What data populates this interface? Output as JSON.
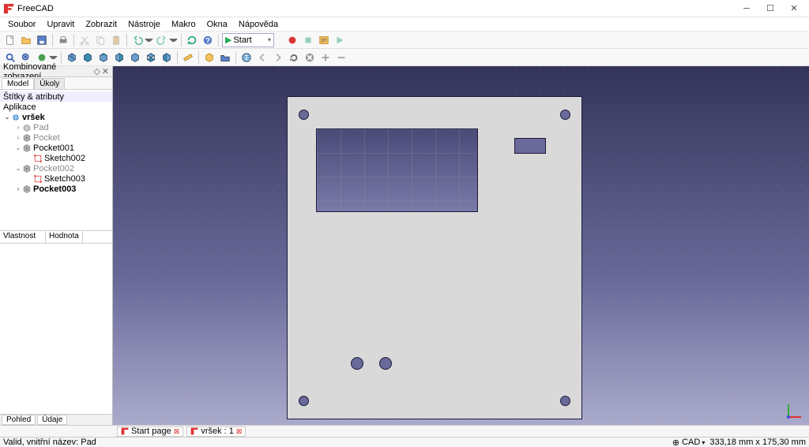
{
  "title": "FreeCAD",
  "menu": [
    "Soubor",
    "Upravit",
    "Zobrazit",
    "Nástroje",
    "Makro",
    "Okna",
    "Nápověda"
  ],
  "macro_selector": "Start",
  "panel": {
    "title": "Kombinované zobrazení",
    "tabs": [
      "Model",
      "Úkoly"
    ],
    "header1": "Štítky & atributy",
    "header2": "Aplikace",
    "tree": [
      {
        "label": "vršek",
        "depth": 0,
        "twist": "v",
        "bold": true,
        "icon": "doc"
      },
      {
        "label": "Pad",
        "depth": 1,
        "twist": ">",
        "gray": true,
        "icon": "pad"
      },
      {
        "label": "Pocket",
        "depth": 1,
        "twist": ">",
        "gray": true,
        "icon": "pocket"
      },
      {
        "label": "Pocket001",
        "depth": 1,
        "twist": "v",
        "icon": "pocket"
      },
      {
        "label": "Sketch002",
        "depth": 2,
        "icon": "sketch"
      },
      {
        "label": "Pocket002",
        "depth": 1,
        "twist": "v",
        "gray": true,
        "icon": "pocket"
      },
      {
        "label": "Sketch003",
        "depth": 2,
        "icon": "sketch"
      },
      {
        "label": "Pocket003",
        "depth": 1,
        "twist": ">",
        "bold": true,
        "icon": "pocket"
      }
    ],
    "prop_headers": [
      "Vlastnost",
      "Hodnota"
    ],
    "bottom_tabs": [
      "Pohled",
      "Údaje"
    ]
  },
  "doc_tabs": [
    {
      "label": "Start page",
      "close": true,
      "icon": "fc"
    },
    {
      "label": "vršek : 1",
      "close": true,
      "icon": "fc"
    }
  ],
  "status": {
    "left": "Valid, vnitřní název: Pad",
    "mode": "CAD",
    "dims": "333,18 mm x 175,30 mm"
  },
  "colors": {
    "accent": "#3a5fb0"
  }
}
